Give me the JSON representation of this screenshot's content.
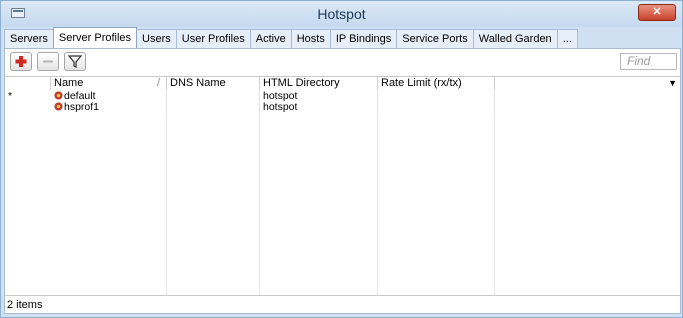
{
  "window": {
    "title": "Hotspot",
    "close_glyph": "✕",
    "title_icon": "window-icon"
  },
  "tabs": [
    {
      "label": "Servers",
      "active": false
    },
    {
      "label": "Server Profiles",
      "active": true
    },
    {
      "label": "Users",
      "active": false
    },
    {
      "label": "User Profiles",
      "active": false
    },
    {
      "label": "Active",
      "active": false
    },
    {
      "label": "Hosts",
      "active": false
    },
    {
      "label": "IP Bindings",
      "active": false
    },
    {
      "label": "Service Ports",
      "active": false
    },
    {
      "label": "Walled Garden",
      "active": false
    },
    {
      "label": "...",
      "active": false
    }
  ],
  "toolbar": {
    "add_icon": "plus-icon",
    "remove_icon": "minus-icon",
    "filter_icon": "filter-icon",
    "find_placeholder": "Find"
  },
  "table": {
    "columns": [
      {
        "label": "Name",
        "sort_glyph": "/"
      },
      {
        "label": "DNS Name"
      },
      {
        "label": "HTML Directory"
      },
      {
        "label": "Rate Limit (rx/tx)"
      }
    ],
    "column_menu_glyph": "▼",
    "rows": [
      {
        "marker": "*",
        "name": "default",
        "dns_name": "",
        "html_directory": "hotspot",
        "rate_limit": ""
      },
      {
        "marker": "",
        "name": "hsprof1",
        "dns_name": "",
        "html_directory": "hotspot",
        "rate_limit": ""
      }
    ],
    "icon_color": "#c0392b"
  },
  "status": {
    "items": "2 items"
  }
}
